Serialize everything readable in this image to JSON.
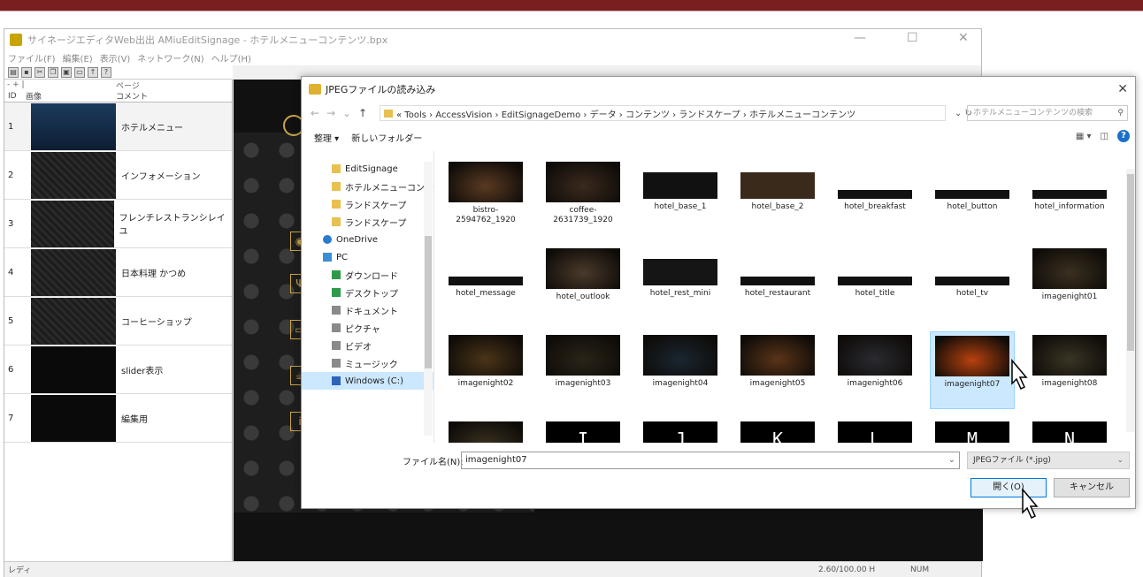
{
  "app": {
    "title": "サイネージエディタWeb出出 AMiuEditSignage - ホテルメニューコンテンツ.bpx",
    "menu": [
      "ファイル(F)",
      "編集(E)",
      "表示(V)",
      "ネットワーク(N)",
      "ヘルプ(H)"
    ],
    "pagelist_header_page": "ページ",
    "pagelist_header_id": "ID",
    "pagelist_header_image": "画像",
    "pagelist_header_comment": "コメント",
    "pages": [
      {
        "id": "1",
        "comment": "ホテルメニュー"
      },
      {
        "id": "2",
        "comment": "インフォメーション"
      },
      {
        "id": "3",
        "comment": "フレンチレストランシレイユ"
      },
      {
        "id": "4",
        "comment": "日本料理 かつめ"
      },
      {
        "id": "5",
        "comment": "コーヒーショップ"
      },
      {
        "id": "6",
        "comment": "slider表示"
      },
      {
        "id": "7",
        "comment": "編集用"
      }
    ],
    "status": "レディ",
    "coords": "2.60/100.00 H",
    "num": "NUM"
  },
  "dialog": {
    "title": "JPEGファイルの読み込み",
    "path": [
      "Tools",
      "AccessVision",
      "EditSignageDemo",
      "データ",
      "コンテンツ",
      "ランドスケープ",
      "ホテルメニューコンテンツ"
    ],
    "path_text": "« Tools › AccessVision › EditSignageDemo › データ › コンテンツ › ランドスケープ › ホテルメニューコンテンツ",
    "search_placeholder": "ホテルメニューコンテンツの検索",
    "organize": "整理 ▾",
    "new_folder": "新しいフォルダー",
    "tree": [
      {
        "label": "EditSignage",
        "icon": "folder"
      },
      {
        "label": "ホテルメニューコンテ",
        "icon": "folder"
      },
      {
        "label": "ランドスケープ",
        "icon": "folder"
      },
      {
        "label": "ランドスケープ",
        "icon": "folder"
      },
      {
        "label": "OneDrive",
        "icon": "cloud"
      },
      {
        "label": "PC",
        "icon": "pc"
      },
      {
        "label": "ダウンロード",
        "icon": "green"
      },
      {
        "label": "デスクトップ",
        "icon": "green"
      },
      {
        "label": "ドキュメント",
        "icon": "gray"
      },
      {
        "label": "ピクチャ",
        "icon": "gray"
      },
      {
        "label": "ビデオ",
        "icon": "gray"
      },
      {
        "label": "ミュージック",
        "icon": "gray"
      },
      {
        "label": "Windows (C:)",
        "icon": "blue"
      }
    ],
    "files": [
      {
        "name": "bistro-2594762_1920",
        "kind": "photo",
        "color": "#5a3a22"
      },
      {
        "name": "coffee-2631739_1920",
        "kind": "photo",
        "color": "#3b2a1e"
      },
      {
        "name": "hotel_base_1",
        "kind": "strip",
        "color": "#111111"
      },
      {
        "name": "hotel_base_2",
        "kind": "strip",
        "color": "#3a2a1c"
      },
      {
        "name": "hotel_breakfast",
        "kind": "strip2",
        "color": "#111111"
      },
      {
        "name": "hotel_button",
        "kind": "strip2",
        "color": "#111111"
      },
      {
        "name": "hotel_information",
        "kind": "strip2",
        "color": "#111111"
      },
      {
        "name": "hotel_message",
        "kind": "strip2",
        "color": "#111111"
      },
      {
        "name": "hotel_outlook",
        "kind": "photo",
        "color": "#4a3a2a"
      },
      {
        "name": "hotel_rest_mini",
        "kind": "strip",
        "color": "#151515"
      },
      {
        "name": "hotel_restaurant",
        "kind": "strip2",
        "color": "#111111"
      },
      {
        "name": "hotel_title",
        "kind": "strip2",
        "color": "#111111"
      },
      {
        "name": "hotel_tv",
        "kind": "strip2",
        "color": "#111111"
      },
      {
        "name": "imagenight01",
        "kind": "photo",
        "color": "#3a3020"
      },
      {
        "name": "imagenight02",
        "kind": "photo",
        "color": "#4a3418"
      },
      {
        "name": "imagenight03",
        "kind": "photo",
        "color": "#2a2418"
      },
      {
        "name": "imagenight04",
        "kind": "photo",
        "color": "#1a2630"
      },
      {
        "name": "imagenight05",
        "kind": "photo",
        "color": "#5a3418"
      },
      {
        "name": "imagenight06",
        "kind": "photo",
        "color": "#2a2a30"
      },
      {
        "name": "imagenight07",
        "kind": "photo",
        "color": "#b8420e"
      },
      {
        "name": "imagenight08",
        "kind": "photo",
        "color": "#3a3424"
      },
      {
        "name": "",
        "kind": "photo",
        "color": "#3a3220"
      },
      {
        "name": "I",
        "kind": "letter",
        "color": "#000000"
      },
      {
        "name": "J",
        "kind": "letter",
        "color": "#000000"
      },
      {
        "name": "K",
        "kind": "letter",
        "color": "#000000"
      },
      {
        "name": "L",
        "kind": "letter",
        "color": "#000000"
      },
      {
        "name": "M",
        "kind": "letter",
        "color": "#000000"
      },
      {
        "name": "N",
        "kind": "letter",
        "color": "#000000"
      }
    ],
    "selected_file": "imagenight07",
    "filename_label": "ファイル名(N):",
    "filename_value": "imagenight07",
    "filetype": "JPEGファイル (*.jpg)",
    "open_button": "開く(O)",
    "cancel_button": "キャンセル",
    "accent": "#0078d7"
  }
}
